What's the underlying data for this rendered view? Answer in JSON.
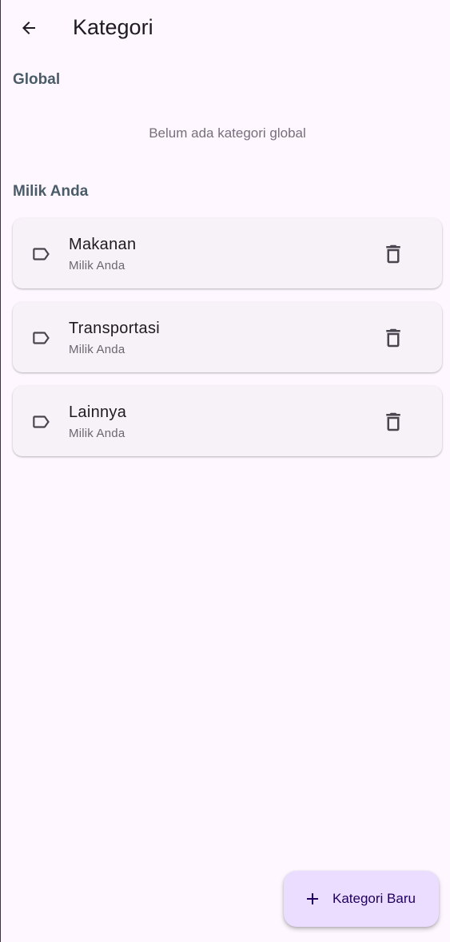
{
  "app_bar": {
    "title": "Kategori",
    "back_icon": "arrow-back-icon"
  },
  "sections": {
    "global": {
      "header": "Global",
      "empty_text": "Belum ada kategori global"
    },
    "mine": {
      "header": "Milik Anda"
    }
  },
  "categories": [
    {
      "name": "Makanan",
      "owner": "Milik Anda",
      "icon": "label-icon",
      "action_icon": "delete-icon"
    },
    {
      "name": "Transportasi",
      "owner": "Milik Anda",
      "icon": "label-icon",
      "action_icon": "delete-icon"
    },
    {
      "name": "Lainnya",
      "owner": "Milik Anda",
      "icon": "label-icon",
      "action_icon": "delete-icon"
    }
  ],
  "fab": {
    "label": "Kategori Baru",
    "icon": "add-icon"
  },
  "colors": {
    "background": "#fef7ff",
    "card": "#f7f2f8",
    "section_header": "#4a5c68",
    "fab_background": "#eaddff",
    "fab_text": "#21005d"
  }
}
